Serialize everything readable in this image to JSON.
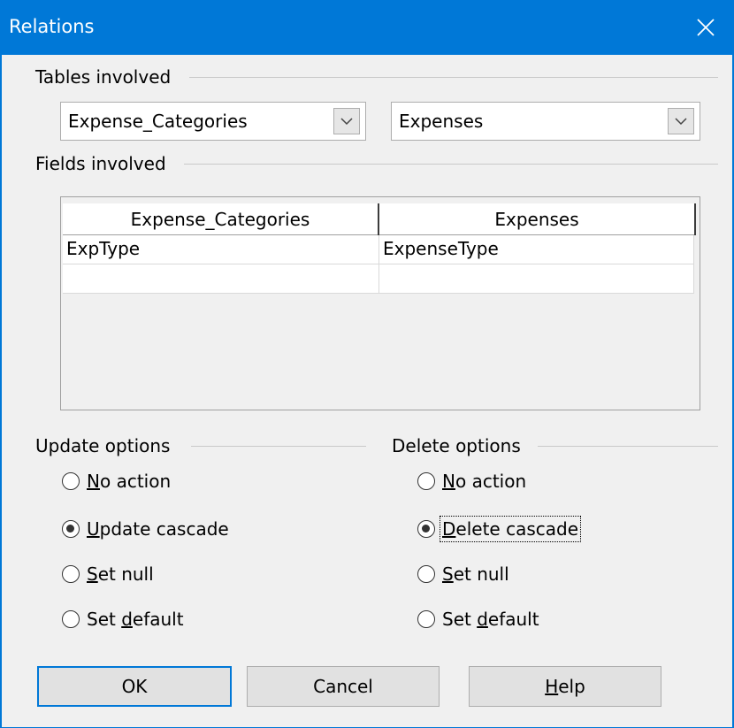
{
  "window": {
    "title": "Relations"
  },
  "tables_involved": {
    "label": "Tables involved",
    "left_table": "Expense_Categories",
    "right_table": "Expenses"
  },
  "fields_involved": {
    "label": "Fields involved",
    "columns": [
      "Expense_Categories",
      "Expenses"
    ],
    "rows": [
      [
        "ExpType",
        "ExpenseType"
      ],
      [
        "",
        ""
      ]
    ]
  },
  "update_options": {
    "label": "Update options",
    "options": [
      {
        "pre": "",
        "key": "N",
        "post": "o action",
        "selected": false
      },
      {
        "pre": "",
        "key": "U",
        "post": "pdate cascade",
        "selected": true
      },
      {
        "pre": "",
        "key": "S",
        "post": "et null",
        "selected": false
      },
      {
        "pre": "Set ",
        "key": "d",
        "post": "efault",
        "selected": false
      }
    ]
  },
  "delete_options": {
    "label": "Delete options",
    "options": [
      {
        "pre": "",
        "key": "N",
        "post": "o action",
        "selected": false
      },
      {
        "pre": "",
        "key": "D",
        "post": "elete cascade",
        "selected": true
      },
      {
        "pre": "",
        "key": "S",
        "post": "et null",
        "selected": false
      },
      {
        "pre": "Set ",
        "key": "d",
        "post": "efault",
        "selected": false
      }
    ]
  },
  "buttons": {
    "ok": "OK",
    "cancel": "Cancel",
    "help": {
      "key": "H",
      "rest": "elp"
    }
  },
  "colors": {
    "accent": "#0078d7",
    "dialog_bg": "#f0f0f0",
    "button_bg": "#e1e1e1"
  }
}
